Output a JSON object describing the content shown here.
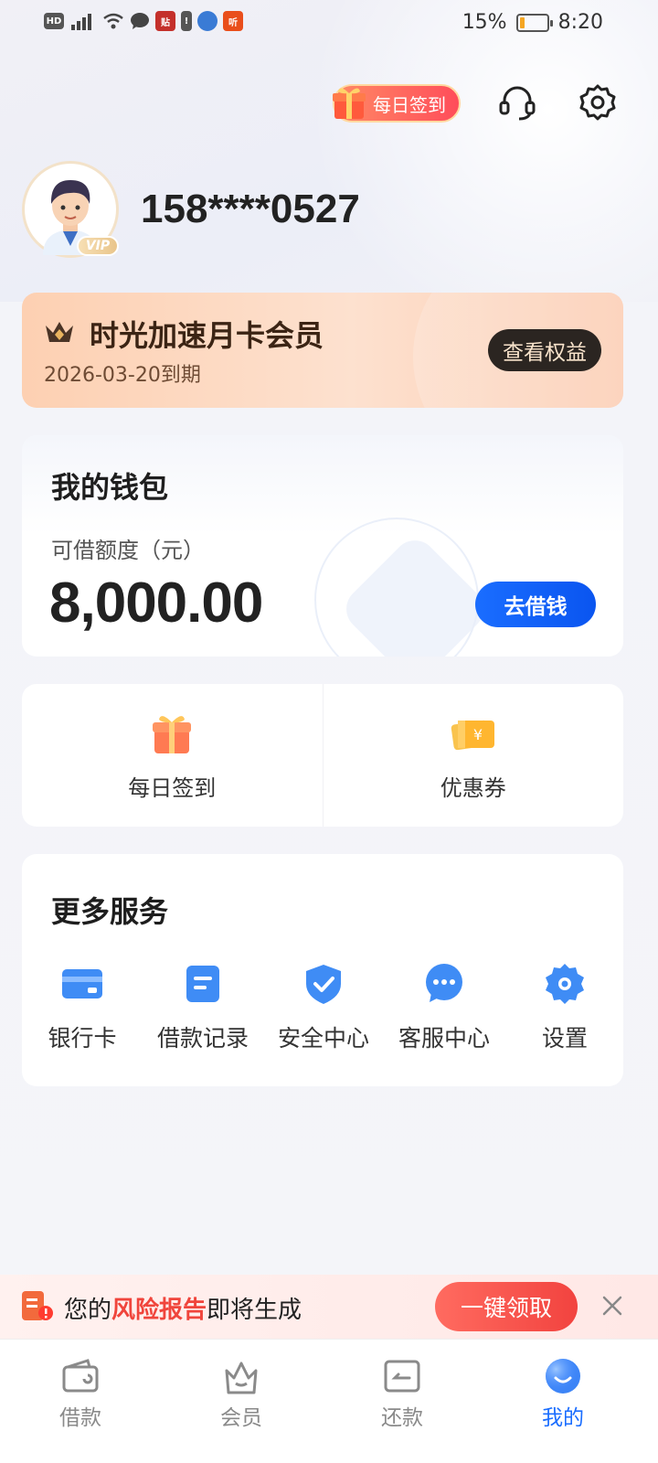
{
  "status_bar": {
    "battery": "15%",
    "time": "8:20",
    "battery_level": 0.15
  },
  "header": {
    "daily_checkin_label": "每日签到",
    "icons": [
      "customer-service-icon",
      "settings-gear-icon"
    ]
  },
  "profile": {
    "phone": "158****0527",
    "vip_badge": "VIP"
  },
  "membership": {
    "title": "时光加速月卡会员",
    "expiry": "2026-03-20到期",
    "view_rights_label": "查看权益"
  },
  "wallet": {
    "title": "我的钱包",
    "credit_label": "可借额度（元）",
    "amount": "8,000.00",
    "borrow_label": "去借钱"
  },
  "quick_actions": [
    {
      "label": "每日签到",
      "icon": "gift-icon"
    },
    {
      "label": "优惠券",
      "icon": "coupon-icon"
    }
  ],
  "services": {
    "title": "更多服务",
    "items": [
      {
        "label": "银行卡",
        "icon": "bank-card-icon"
      },
      {
        "label": "借款记录",
        "icon": "loan-record-icon"
      },
      {
        "label": "安全中心",
        "icon": "security-shield-icon"
      },
      {
        "label": "客服中心",
        "icon": "chat-bubble-icon"
      },
      {
        "label": "设置",
        "icon": "settings-gear-icon"
      }
    ]
  },
  "risk_banner": {
    "prefix": "您的",
    "highlight": "风险报告",
    "suffix": "即将生成",
    "claim_label": "一键领取"
  },
  "tabbar": {
    "active": "我的",
    "tabs": [
      {
        "label": "借款",
        "icon": "wallet-icon"
      },
      {
        "label": "会员",
        "icon": "crown-basket-icon"
      },
      {
        "label": "还款",
        "icon": "repay-card-icon"
      },
      {
        "label": "我的",
        "icon": "profile-bubble-icon"
      }
    ]
  },
  "colors": {
    "accent_blue": "#1a6dff",
    "highlight_red": "#f0453c",
    "member_card_bg": "#fdd0b2"
  }
}
